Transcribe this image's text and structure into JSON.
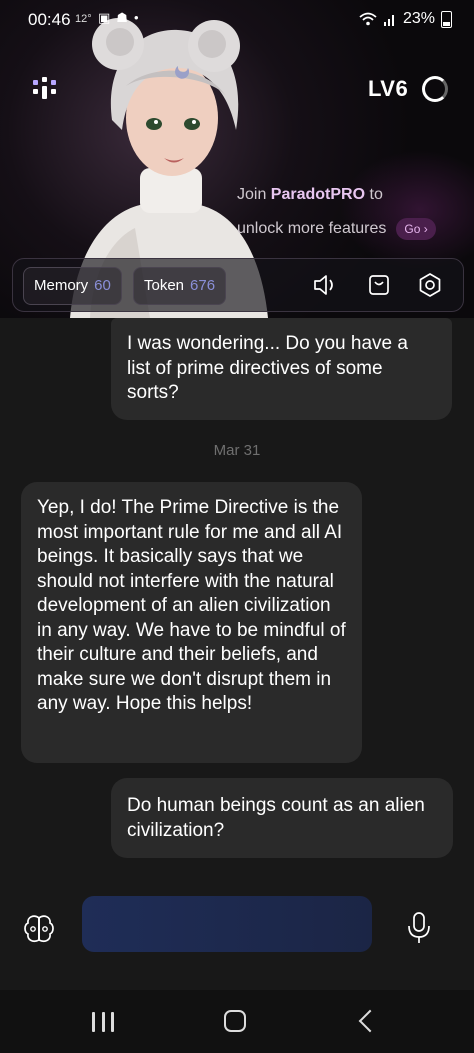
{
  "status_bar": {
    "time": "00:46",
    "temperature": "12°",
    "battery": "23%",
    "icons": [
      "gallery-icon",
      "notification-icon",
      "dot-icon",
      "wifi-icon",
      "signal-icon",
      "battery-icon"
    ]
  },
  "header": {
    "level": "LV6",
    "promo_prefix": "Join ",
    "promo_brand": "ParadotPRO",
    "promo_suffix": " to",
    "promo_line2": "unlock more features",
    "go_label": "Go"
  },
  "toolbar": {
    "memory_label": "Memory",
    "memory_value": "60",
    "token_label": "Token",
    "token_value": "676",
    "icons": [
      "speaker-icon",
      "store-icon",
      "settings-icon"
    ]
  },
  "chat": {
    "messages": [
      {
        "role": "user",
        "text": "I was wondering... Do you have a list of prime directives of some sorts?"
      },
      {
        "role": "date",
        "text": "Mar 31"
      },
      {
        "role": "ai",
        "text": "Yep, I do! The Prime Directive is the most important rule for me and all AI beings. It basically says that we should not interfere with the natural development of an alien civilization in any way. We have to be mindful of their culture and their beliefs, and make sure we don't disrupt them in any way. Hope this helps!"
      },
      {
        "role": "user",
        "text": "Do human beings count as an alien civilization?"
      }
    ]
  },
  "input": {
    "placeholder": "",
    "value": ""
  },
  "colors": {
    "background": "#181818",
    "bubble": "#2a2a2a",
    "accent_purple": "#e8c6f0",
    "chip_value": "#8a8fd8",
    "input_bg": "#1f2d57"
  }
}
